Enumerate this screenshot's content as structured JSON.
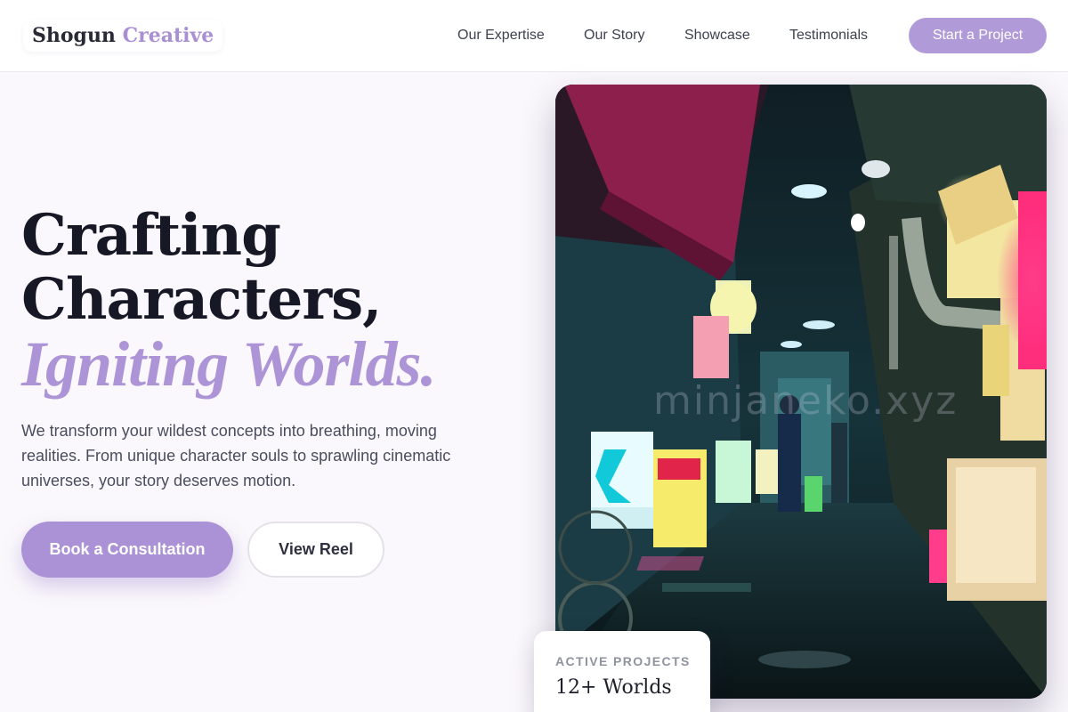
{
  "brand": {
    "name_primary": "Shogun",
    "name_accent": "Creative",
    "accent_color": "#ab92d6"
  },
  "nav": {
    "links": [
      "Our Expertise",
      "Our Story",
      "Showcase",
      "Testimonials"
    ],
    "cta_label": "Start a Project"
  },
  "hero": {
    "title_line1": "Crafting",
    "title_line2": "Characters,",
    "title_accent": "Igniting Worlds.",
    "description": "We transform your wildest concepts into breathing, moving realities. From unique character souls to sprawling cinematic universes, your story deserves motion.",
    "primary_button": "Book a Consultation",
    "secondary_button": "View Reel",
    "image_watermark": "minjaneko.xyz"
  },
  "stat_card": {
    "label": "ACTIVE PROJECTS",
    "value": "12+ Worlds"
  }
}
